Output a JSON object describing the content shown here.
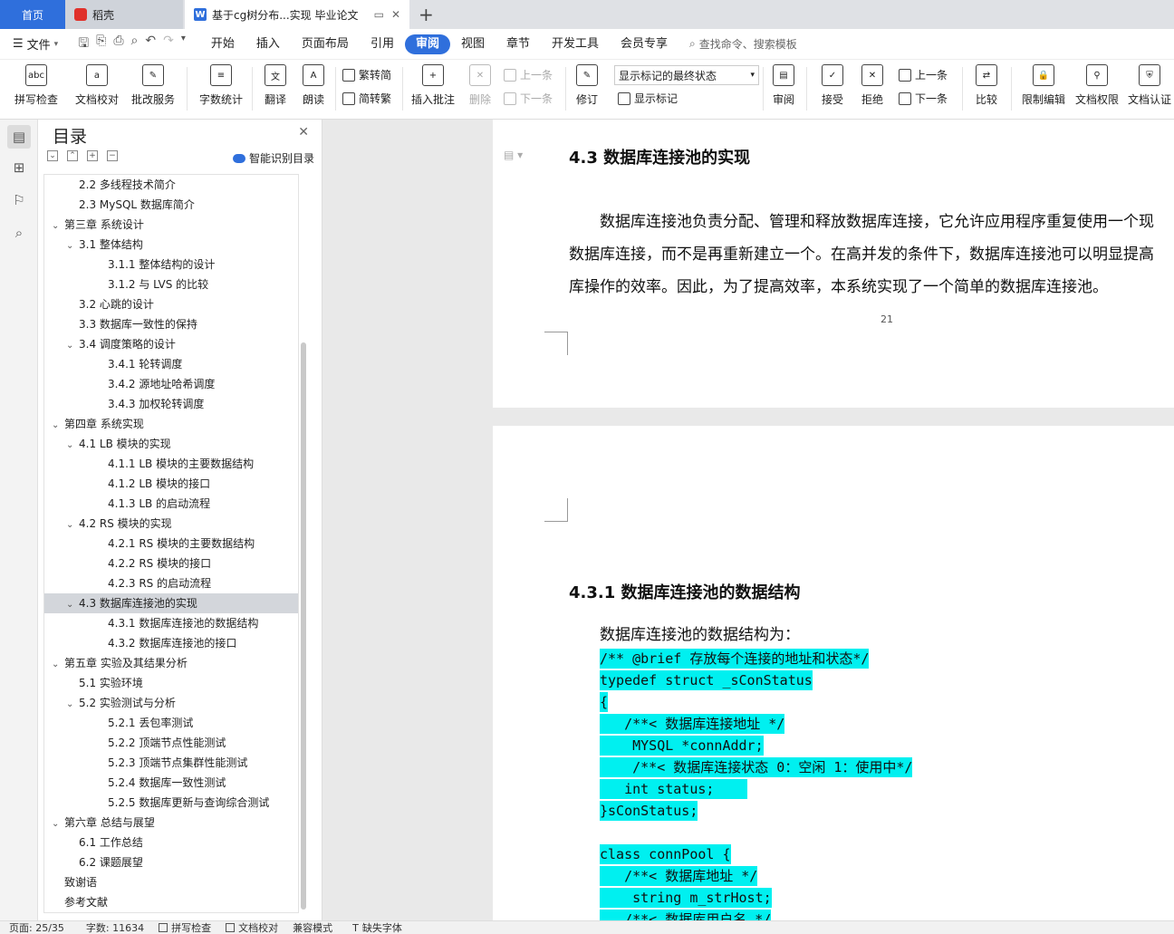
{
  "tabs": {
    "home": "首页",
    "daoke": "稻壳",
    "document": "基于cg树分布...实现 毕业论文"
  },
  "menu": {
    "file": "文件",
    "items": [
      "开始",
      "插入",
      "页面布局",
      "引用",
      "审阅",
      "视图",
      "章节",
      "开发工具",
      "会员专享"
    ],
    "active_index": 4,
    "search_placeholder": "查找命令、搜索模板"
  },
  "ribbon": {
    "spell_check": "拼写检查",
    "doc_proof": "文档校对",
    "batch_service": "批改服务",
    "word_count": "字数统计",
    "translate": "翻译",
    "read_aloud": "朗读",
    "to_traditional": "繁转简",
    "to_simplified": "简转繁",
    "insert_comment": "插入批注",
    "delete": "删除",
    "prev_comment": "上一条",
    "next_comment": "下一条",
    "revise": "修订",
    "display_state": "显示标记的最终状态",
    "show_marks": "显示标记",
    "review": "审阅",
    "accept": "接受",
    "reject": "拒绝",
    "prev_change": "上一条",
    "next_change": "下一条",
    "compare": "比较",
    "restrict_edit": "限制编辑",
    "doc_permission": "文档权限",
    "doc_cert": "文档认证"
  },
  "toc": {
    "title": "目录",
    "smart_recognize": "智能识别目录",
    "items": [
      {
        "text": "2.2  多线程技术简介",
        "level": 2,
        "arrow": false
      },
      {
        "text": "2.3 MySQL 数据库简介",
        "level": 2,
        "arrow": false
      },
      {
        "text": "第三章  系统设计",
        "level": 1,
        "arrow": true
      },
      {
        "text": "3.1  整体结构",
        "level": 2,
        "arrow": true
      },
      {
        "text": "3.1.1  整体结构的设计",
        "level": 3,
        "arrow": false
      },
      {
        "text": "3.1.2  与 LVS 的比较",
        "level": 3,
        "arrow": false
      },
      {
        "text": "3.2  心跳的设计",
        "level": 2,
        "arrow": false
      },
      {
        "text": "3.3  数据库一致性的保持",
        "level": 2,
        "arrow": false
      },
      {
        "text": "3.4  调度策略的设计",
        "level": 2,
        "arrow": true
      },
      {
        "text": "3.4.1  轮转调度",
        "level": 3,
        "arrow": false
      },
      {
        "text": "3.4.2  源地址哈希调度",
        "level": 3,
        "arrow": false
      },
      {
        "text": "3.4.3  加权轮转调度",
        "level": 3,
        "arrow": false
      },
      {
        "text": "第四章  系统实现",
        "level": 1,
        "arrow": true
      },
      {
        "text": "4.1 LB 模块的实现",
        "level": 2,
        "arrow": true
      },
      {
        "text": "4.1.1 LB 模块的主要数据结构",
        "level": 3,
        "arrow": false
      },
      {
        "text": "4.1.2 LB 模块的接口",
        "level": 3,
        "arrow": false
      },
      {
        "text": "4.1.3 LB 的启动流程",
        "level": 3,
        "arrow": false
      },
      {
        "text": "4.2 RS 模块的实现",
        "level": 2,
        "arrow": true
      },
      {
        "text": "4.2.1 RS 模块的主要数据结构",
        "level": 3,
        "arrow": false
      },
      {
        "text": "4.2.2 RS 模块的接口",
        "level": 3,
        "arrow": false
      },
      {
        "text": "4.2.3 RS 的启动流程",
        "level": 3,
        "arrow": false
      },
      {
        "text": "4.3  数据库连接池的实现",
        "level": 2,
        "arrow": true,
        "selected": true
      },
      {
        "text": "4.3.1  数据库连接池的数据结构",
        "level": 3,
        "arrow": false
      },
      {
        "text": "4.3.2  数据库连接池的接口",
        "level": 3,
        "arrow": false
      },
      {
        "text": "第五章  实验及其结果分析",
        "level": 1,
        "arrow": true
      },
      {
        "text": "5.1  实验环境",
        "level": 2,
        "arrow": false
      },
      {
        "text": "5.2  实验测试与分析",
        "level": 2,
        "arrow": true
      },
      {
        "text": "5.2.1  丢包率测试",
        "level": 3,
        "arrow": false
      },
      {
        "text": "5.2.2  顶端节点性能测试",
        "level": 3,
        "arrow": false
      },
      {
        "text": "5.2.3  顶端节点集群性能测试",
        "level": 3,
        "arrow": false
      },
      {
        "text": "5.2.4  数据库一致性测试",
        "level": 3,
        "arrow": false
      },
      {
        "text": "5.2.5  数据库更新与查询综合测试",
        "level": 3,
        "arrow": false
      },
      {
        "text": "第六章  总结与展望",
        "level": 1,
        "arrow": true
      },
      {
        "text": "6.1  工作总结",
        "level": 2,
        "arrow": false
      },
      {
        "text": "6.2  课题展望",
        "level": 2,
        "arrow": false
      },
      {
        "text": "致谢语",
        "level": 1,
        "arrow": false
      },
      {
        "text": "参考文献",
        "level": 1,
        "arrow": false
      }
    ]
  },
  "document": {
    "heading_43": "4.3  数据库连接池的实现",
    "para_lines": [
      "数据库连接池负责分配、管理和释放数据库连接，它允许应用程序重复使用一个现",
      "数据库连接，而不是再重新建立一个。在高并发的条件下，数据库连接池可以明显提高",
      "库操作的效率。因此，为了提高效率，本系统实现了一个简单的数据库连接池。"
    ],
    "page_number": "21",
    "heading_431": "4.3.1  数据库连接池的数据结构",
    "intro": "数据库连接池的数据结构为：",
    "code_lines": [
      "/** @brief 存放每个连接的地址和状态*/",
      "typedef struct _sConStatus",
      "{",
      "   /**< 数据库连接地址 */",
      "    MYSQL *connAddr;",
      "    /**< 数据库连接状态 0：空闲 1：使用中*/",
      "   int status;    ",
      "}sConStatus;",
      "",
      "class connPool {",
      "   /**< 数据库地址 */",
      "    string m_strHost;",
      "   /**< 数据库用户名 */"
    ]
  },
  "status": {
    "page": "页面: 25/35",
    "words": "字数: 11634",
    "spell": "拼写检查",
    "proof": "文档校对",
    "compat": "兼容模式",
    "missing_font": "缺失字体"
  },
  "colors": {
    "accent": "#2f6fdc",
    "highlight": "#00f0f0"
  }
}
